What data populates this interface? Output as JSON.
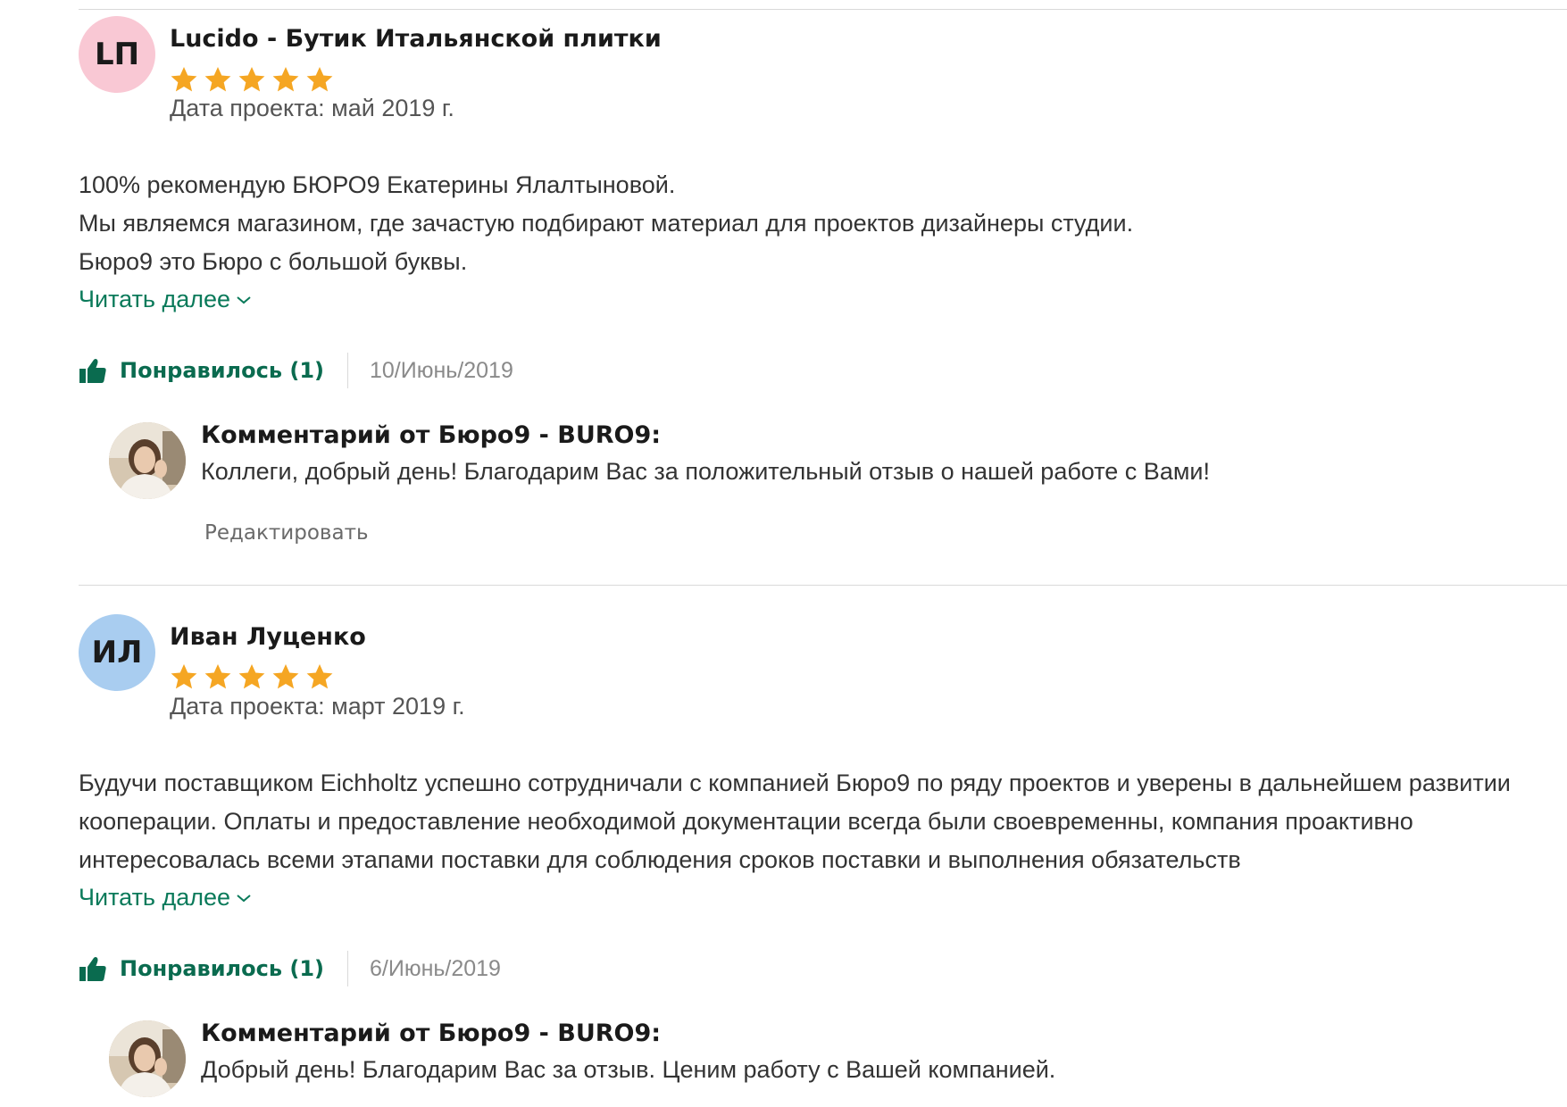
{
  "colors": {
    "accent_green": "#0a7a5a",
    "star": "#f5a623",
    "avatar_pink": "#f9c8d4",
    "avatar_blue": "#a9cdf0"
  },
  "reviews": [
    {
      "initials": "LП",
      "author": "Lucido - Бутик Итальянской плитки",
      "rating": 5,
      "project_date": "Дата проекта: май 2019 г.",
      "body": [
        "100% рекомендую БЮРО9 Екатерины Ялалтыновой.",
        "Мы являемся магазином, где зачастую подбирают материал для проектов дизайнеры студии.",
        "Бюро9 это Бюро с большой буквы."
      ],
      "read_more": "Читать далее",
      "like_label": "Понравилось (1)",
      "date": "10/Июнь/2019",
      "comment": {
        "title": "Комментарий от Бюро9 - BURO9:",
        "text": "Коллеги, добрый день! Благодарим Вас за положительный отзыв о нашей работе с Вами!",
        "edit_label": "Редактировать"
      }
    },
    {
      "initials": "ИЛ",
      "author": "Иван Луценко",
      "rating": 5,
      "project_date": "Дата проекта: март 2019 г.",
      "body": [
        "Будучи поставщиком Eichholtz успешно сотрудничали с компанией Бюро9 по ряду проектов и уверены в дальнейшем развитии кооперации. Оплаты и предоставление необходимой документации всегда были своевременны, компания проактивно интересовалась всеми этапами поставки для соблюдения сроков поставки и выполнения обязательств"
      ],
      "read_more": "Читать далее",
      "like_label": "Понравилось (1)",
      "date": "6/Июнь/2019",
      "comment": {
        "title": "Комментарий от Бюро9 - BURO9:",
        "text": "Добрый день! Благодарим Вас за отзыв. Ценим работу с Вашей компанией."
      }
    }
  ]
}
